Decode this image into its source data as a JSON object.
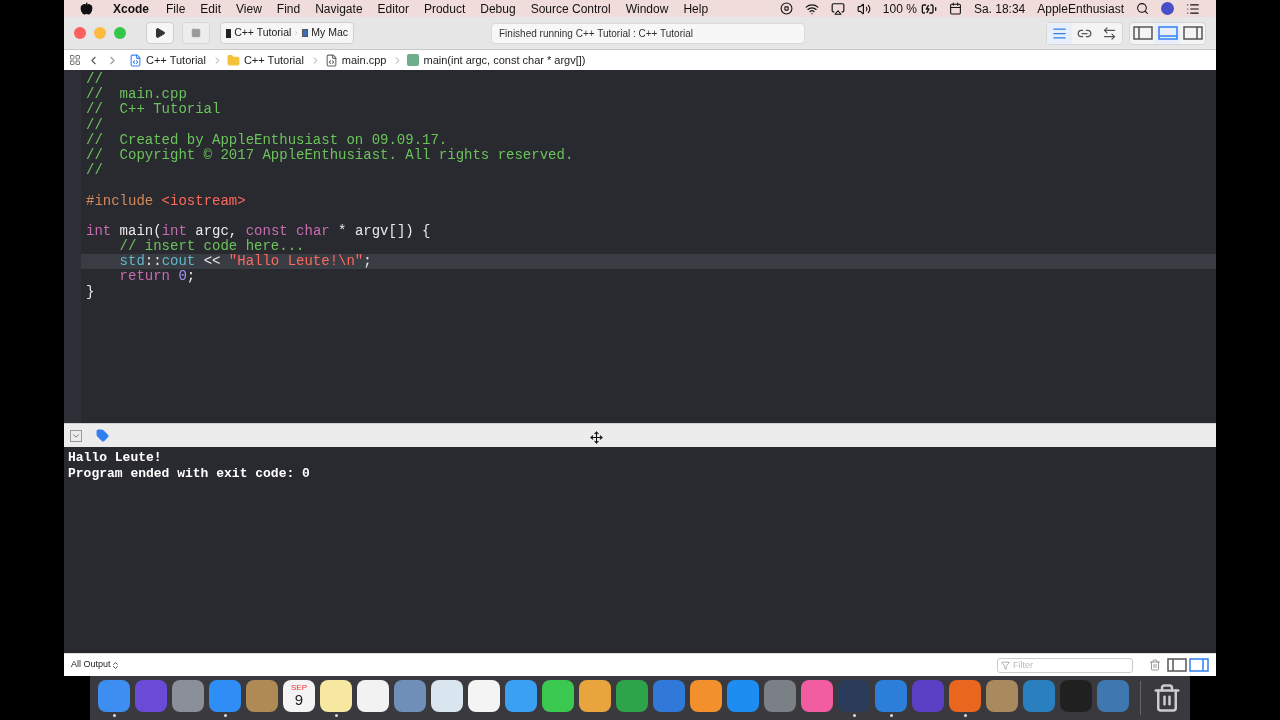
{
  "menu_bar": {
    "app": "Xcode",
    "items": [
      "File",
      "Edit",
      "View",
      "Find",
      "Navigate",
      "Editor",
      "Product",
      "Debug",
      "Source Control",
      "Window",
      "Help"
    ],
    "battery": "100 %",
    "clock": "Sa. 18:34",
    "user": "AppleEnthusiast"
  },
  "toolbar": {
    "scheme": "C++ Tutorial",
    "destination": "My Mac",
    "status": "Finished running C++ Tutorial : C++ Tutorial",
    "editor_modes": [
      {
        "kind": "standard",
        "selected": true
      },
      {
        "kind": "assistant",
        "selected": false
      },
      {
        "kind": "version",
        "selected": false
      }
    ],
    "panels": [
      {
        "kind": "navigator",
        "selected": false
      },
      {
        "kind": "debug",
        "selected": true
      },
      {
        "kind": "utilities",
        "selected": false
      }
    ]
  },
  "jump_bar": [
    {
      "kind": "project",
      "label": "C++ Tutorial"
    },
    {
      "kind": "folder",
      "label": "C++ Tutorial"
    },
    {
      "kind": "file",
      "label": "main.cpp"
    },
    {
      "kind": "function",
      "label": "main(int argc, const char * argv[])"
    }
  ],
  "editor": {
    "lines": [
      {
        "selected": false,
        "tokens": [
          {
            "kind": "comment",
            "text": "//"
          }
        ]
      },
      {
        "selected": false,
        "tokens": [
          {
            "kind": "comment",
            "text": "//  main.cpp"
          }
        ]
      },
      {
        "selected": false,
        "tokens": [
          {
            "kind": "comment",
            "text": "//  C++ Tutorial"
          }
        ]
      },
      {
        "selected": false,
        "tokens": [
          {
            "kind": "comment",
            "text": "//"
          }
        ]
      },
      {
        "selected": false,
        "tokens": [
          {
            "kind": "comment",
            "text": "//  Created by AppleEnthusiast on 09.09.17."
          }
        ]
      },
      {
        "selected": false,
        "tokens": [
          {
            "kind": "comment",
            "text": "//  Copyright © 2017 AppleEnthusiast. All rights reserved."
          }
        ]
      },
      {
        "selected": false,
        "tokens": [
          {
            "kind": "comment",
            "text": "//"
          }
        ]
      },
      {
        "selected": false
      },
      {
        "selected": false,
        "tokens": [
          {
            "kind": "preprocessor",
            "text": "#include"
          },
          {
            "kind": "string",
            "text": " <iostream>"
          }
        ]
      },
      {
        "selected": false
      },
      {
        "selected": false,
        "tokens": [
          {
            "kind": "keyword",
            "text": "int"
          },
          {
            "kind": "plain",
            "text": " main("
          },
          {
            "kind": "keyword",
            "text": "int"
          },
          {
            "kind": "plain",
            "text": " argc, "
          },
          {
            "kind": "keyword",
            "text": "const char"
          },
          {
            "kind": "plain",
            "text": " * argv[]) {"
          }
        ]
      },
      {
        "selected": false,
        "tokens": [
          {
            "kind": "comment",
            "text": "    // insert code here..."
          }
        ]
      },
      {
        "selected": true,
        "tokens": [
          {
            "kind": "library",
            "text": "    std"
          },
          {
            "kind": "plain",
            "text": "::"
          },
          {
            "kind": "library",
            "text": "cout"
          },
          {
            "kind": "plain",
            "text": " << "
          },
          {
            "kind": "string",
            "text": "\"Hallo Leute!\\n\""
          },
          {
            "kind": "plain",
            "text": ";"
          }
        ]
      },
      {
        "selected": false,
        "tokens": [
          {
            "kind": "keyword",
            "text": "    return"
          },
          {
            "kind": "number",
            "text": " 0"
          },
          {
            "kind": "plain",
            "text": ";"
          }
        ]
      },
      {
        "selected": false,
        "tokens": [
          {
            "kind": "plain",
            "text": "}"
          }
        ]
      }
    ]
  },
  "debug_bar": {
    "breakpoints_active": true
  },
  "console": {
    "lines": [
      "Hallo Leute!",
      "Program ended with exit code: 0"
    ]
  },
  "bottom_bar": {
    "output_filter": "All Output",
    "search": {
      "placeholder": "Filter"
    },
    "panes": [
      {
        "kind": "variables",
        "selected": false
      },
      {
        "kind": "console",
        "selected": true
      }
    ]
  },
  "dock": [
    {
      "color": "#3d8ef0",
      "running": true
    },
    {
      "color": "#6a4bd8",
      "running": false
    },
    {
      "color": "#8a8f99",
      "running": false
    },
    {
      "color": "#2f8ef5",
      "running": true
    },
    {
      "color": "#b08a55",
      "running": false
    },
    {
      "color": "#f4f4f4",
      "running": false,
      "month": "SEP",
      "day": "9"
    },
    {
      "color": "#f6e7a1",
      "running": true
    },
    {
      "color": "#f2f2f2",
      "running": false
    },
    {
      "color": "#6f8fb8",
      "running": false
    },
    {
      "color": "#d9e6ef",
      "running": false
    },
    {
      "color": "#f4f4f4",
      "running": false
    },
    {
      "color": "#3aa0f2",
      "running": false
    },
    {
      "color": "#3bc850",
      "running": false
    },
    {
      "color": "#e9a53d",
      "running": false
    },
    {
      "color": "#2da44a",
      "running": false
    },
    {
      "color": "#3079d8",
      "running": false
    },
    {
      "color": "#f2902d",
      "running": false
    },
    {
      "color": "#1d8df2",
      "running": false
    },
    {
      "color": "#7b7f86",
      "running": false
    },
    {
      "color": "#f25ca0",
      "running": false
    },
    {
      "color": "#2b3c5a",
      "running": true
    },
    {
      "color": "#2b7fd9",
      "running": true
    },
    {
      "color": "#5b3fc4",
      "running": false
    },
    {
      "color": "#e8661d",
      "running": true
    },
    {
      "color": "#a88a5e",
      "running": false
    },
    {
      "color": "#2a7fbf",
      "running": false
    },
    {
      "color": "#202020",
      "running": false
    },
    {
      "color": "#3f77b0",
      "running": false
    }
  ]
}
